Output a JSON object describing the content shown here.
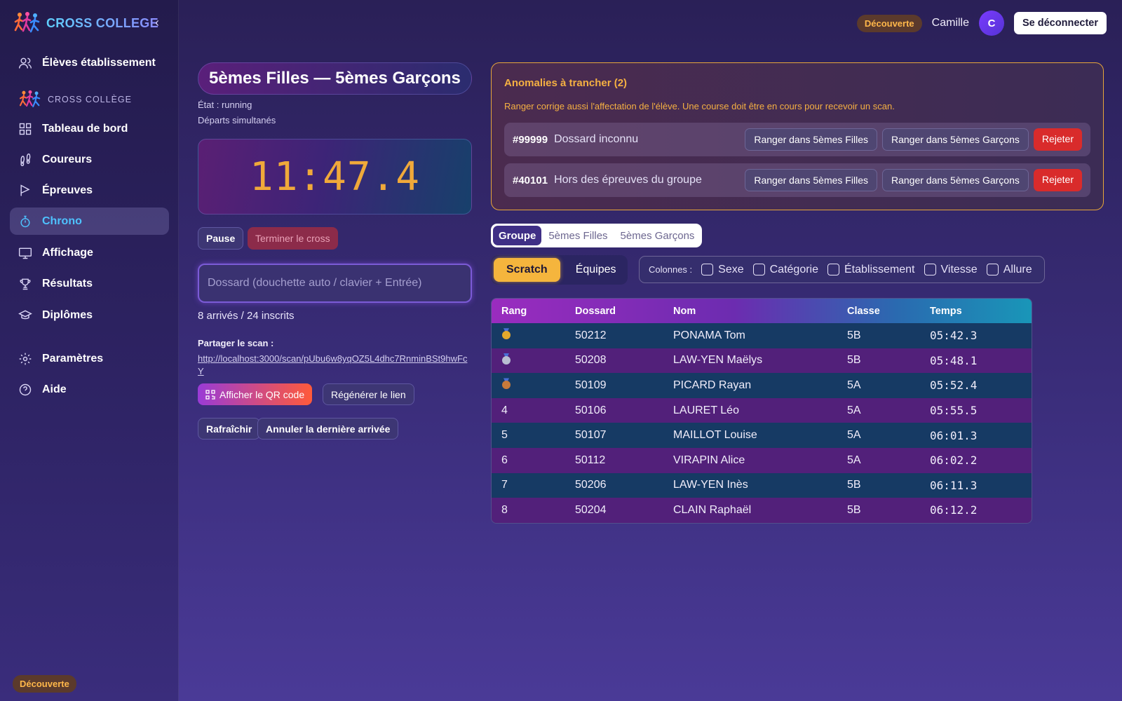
{
  "app": {
    "name": "CROSS COLLEGE",
    "section_label": "CROSS COLLÈGE",
    "plan": "Découverte"
  },
  "sidebar": {
    "items": [
      {
        "label": "Élèves établissement",
        "icon": "users-icon"
      },
      {
        "label": "Tableau de bord",
        "icon": "dashboard-icon"
      },
      {
        "label": "Coureurs",
        "icon": "footprints-icon"
      },
      {
        "label": "Épreuves",
        "icon": "flag-icon"
      },
      {
        "label": "Chrono",
        "icon": "timer-icon",
        "active": true
      },
      {
        "label": "Affichage",
        "icon": "monitor-icon"
      },
      {
        "label": "Résultats",
        "icon": "trophy-icon"
      },
      {
        "label": "Diplômes",
        "icon": "graduation-cap-icon"
      },
      {
        "label": "Paramètres",
        "icon": "gear-icon"
      },
      {
        "label": "Aide",
        "icon": "help-icon"
      }
    ]
  },
  "topbar": {
    "plan": "Découverte",
    "user": "Camille",
    "avatar_initial": "C",
    "logout": "Se déconnecter"
  },
  "race": {
    "title": "5èmes Filles — 5èmes Garçons",
    "state": "État : running",
    "mode": "Départs simultanés",
    "chrono": "11:47.4",
    "pause": "Pause",
    "finish": "Terminer le cross",
    "dossard_placeholder": "Dossard (douchette auto / clavier + Entrée)",
    "count": "8 arrivés / 24 inscrits",
    "share_label": "Partager le scan :",
    "share_url": "http://localhost:3000/scan/pUbu6w8yqOZ5L4dhc7RnminBSt9hwFcY",
    "qr_button": "Afficher le QR code",
    "regen_button": "Régénérer le lien",
    "refresh_button": "Rafraîchir",
    "cancel_button": "Annuler la dernière arrivée"
  },
  "anomalies": {
    "title": "Anomalies à trancher (2)",
    "description": "Ranger corrige aussi l'affectation de l'élève. Une course doit être en cours pour recevoir un scan.",
    "rows": [
      {
        "code": "#99999",
        "reason": "Dossard inconnu",
        "action1": "Ranger dans 5èmes Filles",
        "action2": "Ranger dans 5èmes Garçons",
        "reject": "Rejeter"
      },
      {
        "code": "#40101",
        "reason": "Hors des épreuves du groupe",
        "action1": "Ranger dans 5èmes Filles",
        "action2": "Ranger dans 5èmes Garçons",
        "reject": "Rejeter"
      }
    ]
  },
  "group_tabs": [
    "Groupe",
    "5èmes Filles",
    "5èmes Garçons"
  ],
  "view_tabs": [
    "Scratch",
    "Équipes"
  ],
  "columns": {
    "label": "Colonnes :",
    "options": [
      "Sexe",
      "Catégorie",
      "Établissement",
      "Vitesse",
      "Allure"
    ]
  },
  "table": {
    "headers": [
      "Rang",
      "Dossard",
      "Nom",
      "Classe",
      "Temps"
    ],
    "rows": [
      {
        "rank": "",
        "medal": "gold-medal-icon",
        "dossard": "50212",
        "name": "PONAMA Tom",
        "classe": "5B",
        "time": "05:42.3"
      },
      {
        "rank": "",
        "medal": "silver-medal-icon",
        "dossard": "50208",
        "name": "LAW-YEN Maëlys",
        "classe": "5B",
        "time": "05:48.1"
      },
      {
        "rank": "",
        "medal": "bronze-medal-icon",
        "dossard": "50109",
        "name": "PICARD Rayan",
        "classe": "5A",
        "time": "05:52.4"
      },
      {
        "rank": "4",
        "dossard": "50106",
        "name": "LAURET Léo",
        "classe": "5A",
        "time": "05:55.5"
      },
      {
        "rank": "5",
        "dossard": "50107",
        "name": "MAILLOT Louise",
        "classe": "5A",
        "time": "06:01.3"
      },
      {
        "rank": "6",
        "dossard": "50112",
        "name": "VIRAPIN Alice",
        "classe": "5A",
        "time": "06:02.2"
      },
      {
        "rank": "7",
        "dossard": "50206",
        "name": "LAW-YEN Inès",
        "classe": "5B",
        "time": "06:11.3"
      },
      {
        "rank": "8",
        "dossard": "50204",
        "name": "CLAIN Raphaël",
        "classe": "5B",
        "time": "06:12.2"
      }
    ]
  },
  "colors": {
    "accent": "#4ec2ff",
    "warning": "#f5b042",
    "danger": "#d92b2b",
    "chrono": "#f0a93a",
    "gold": "#e3a82b",
    "silver": "#b9bed1",
    "bronze": "#c77a3a"
  }
}
